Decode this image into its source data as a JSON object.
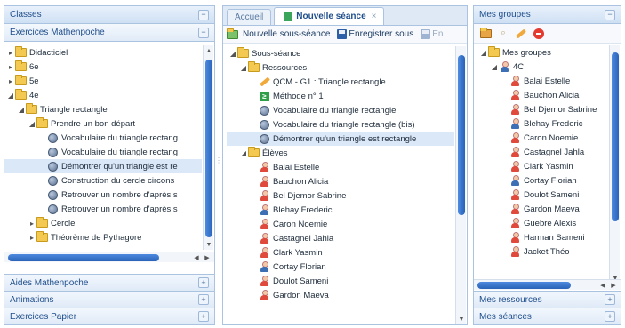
{
  "left": {
    "header": "Classes",
    "subheader": "Exercices Mathenpoche",
    "tree": [
      {
        "indent": 0,
        "arrow": "▸",
        "icon": "folder",
        "label": "Didacticiel"
      },
      {
        "indent": 0,
        "arrow": "▸",
        "icon": "folder",
        "label": "6e"
      },
      {
        "indent": 0,
        "arrow": "▸",
        "icon": "folder",
        "label": "5e"
      },
      {
        "indent": 0,
        "arrow": "◢",
        "icon": "folder",
        "label": "4e"
      },
      {
        "indent": 1,
        "arrow": "◢",
        "icon": "folder",
        "label": "Triangle rectangle"
      },
      {
        "indent": 2,
        "arrow": "◢",
        "icon": "folder",
        "label": "Prendre un bon départ"
      },
      {
        "indent": 3,
        "arrow": "",
        "icon": "globe",
        "label": "Vocabulaire du triangle rectang"
      },
      {
        "indent": 3,
        "arrow": "",
        "icon": "globe",
        "label": "Vocabulaire du triangle rectang"
      },
      {
        "indent": 3,
        "arrow": "",
        "icon": "globe",
        "label": "Démontrer qu'un triangle est re",
        "selected": true
      },
      {
        "indent": 3,
        "arrow": "",
        "icon": "globe",
        "label": "Construction du cercle circons"
      },
      {
        "indent": 3,
        "arrow": "",
        "icon": "globe",
        "label": "Retrouver un nombre d'après s"
      },
      {
        "indent": 3,
        "arrow": "",
        "icon": "globe",
        "label": "Retrouver un nombre d'après s"
      },
      {
        "indent": 2,
        "arrow": "▸",
        "icon": "folder",
        "label": "Cercle"
      },
      {
        "indent": 2,
        "arrow": "▸",
        "icon": "folder",
        "label": "Théorème de Pythagore"
      }
    ],
    "collapsed": [
      "Aides Mathenpoche",
      "Animations",
      "Exercices Papier"
    ]
  },
  "center": {
    "tabs": [
      {
        "label": "Accueil",
        "active": false
      },
      {
        "label": "Nouvelle séance",
        "active": true,
        "close": "×"
      }
    ],
    "toolbar": {
      "new_sub": "Nouvelle sous-séance",
      "save_as": "Enregistrer sous",
      "save": "En"
    },
    "tree": [
      {
        "indent": 0,
        "arrow": "◢",
        "icon": "folder",
        "label": "Sous-séance"
      },
      {
        "indent": 1,
        "arrow": "◢",
        "icon": "folder",
        "label": "Ressources"
      },
      {
        "indent": 2,
        "arrow": "",
        "icon": "pencil",
        "label": "QCM - G1 : Triangle rectangle"
      },
      {
        "indent": 2,
        "arrow": "",
        "icon": "green",
        "label": "Méthode n° 1"
      },
      {
        "indent": 2,
        "arrow": "",
        "icon": "globe",
        "label": "Vocabulaire du triangle rectangle"
      },
      {
        "indent": 2,
        "arrow": "",
        "icon": "globe",
        "label": "Vocabulaire du triangle rectangle (bis)"
      },
      {
        "indent": 2,
        "arrow": "",
        "icon": "globe",
        "label": "Démontrer qu'un triangle est rectangle",
        "selected": true
      },
      {
        "indent": 1,
        "arrow": "◢",
        "icon": "folder",
        "label": "Élèves"
      },
      {
        "indent": 2,
        "arrow": "",
        "icon": "user",
        "label": "Balai Estelle"
      },
      {
        "indent": 2,
        "arrow": "",
        "icon": "user",
        "label": "Bauchon Alicia"
      },
      {
        "indent": 2,
        "arrow": "",
        "icon": "user",
        "label": "Bel Djemor Sabrine"
      },
      {
        "indent": 2,
        "arrow": "",
        "icon": "user-blue",
        "label": "Blehay Frederic"
      },
      {
        "indent": 2,
        "arrow": "",
        "icon": "user",
        "label": "Caron Noemie"
      },
      {
        "indent": 2,
        "arrow": "",
        "icon": "user",
        "label": "Castagnel Jahla"
      },
      {
        "indent": 2,
        "arrow": "",
        "icon": "user",
        "label": "Clark Yasmin"
      },
      {
        "indent": 2,
        "arrow": "",
        "icon": "user-blue",
        "label": "Cortay Florian"
      },
      {
        "indent": 2,
        "arrow": "",
        "icon": "user",
        "label": "Doulot Sameni"
      },
      {
        "indent": 2,
        "arrow": "",
        "icon": "user",
        "label": "Gardon Maeva"
      }
    ]
  },
  "right": {
    "header": "Mes groupes",
    "tree": [
      {
        "indent": 0,
        "arrow": "◢",
        "icon": "folder",
        "label": "Mes groupes"
      },
      {
        "indent": 1,
        "arrow": "◢",
        "icon": "group",
        "label": "4C"
      },
      {
        "indent": 2,
        "arrow": "",
        "icon": "user",
        "label": "Balai Estelle"
      },
      {
        "indent": 2,
        "arrow": "",
        "icon": "user",
        "label": "Bauchon Alicia"
      },
      {
        "indent": 2,
        "arrow": "",
        "icon": "user",
        "label": "Bel Djemor Sabrine"
      },
      {
        "indent": 2,
        "arrow": "",
        "icon": "user-blue",
        "label": "Blehay Frederic"
      },
      {
        "indent": 2,
        "arrow": "",
        "icon": "user",
        "label": "Caron Noemie"
      },
      {
        "indent": 2,
        "arrow": "",
        "icon": "user",
        "label": "Castagnel Jahla"
      },
      {
        "indent": 2,
        "arrow": "",
        "icon": "user",
        "label": "Clark Yasmin"
      },
      {
        "indent": 2,
        "arrow": "",
        "icon": "user-blue",
        "label": "Cortay Florian"
      },
      {
        "indent": 2,
        "arrow": "",
        "icon": "user",
        "label": "Doulot Sameni"
      },
      {
        "indent": 2,
        "arrow": "",
        "icon": "user",
        "label": "Gardon Maeva"
      },
      {
        "indent": 2,
        "arrow": "",
        "icon": "user",
        "label": "Guebre Alexis"
      },
      {
        "indent": 2,
        "arrow": "",
        "icon": "user",
        "label": "Harman Sameni"
      },
      {
        "indent": 2,
        "arrow": "",
        "icon": "user",
        "label": "Jacket Théo"
      }
    ],
    "collapsed": [
      "Mes ressources",
      "Mes séances"
    ]
  }
}
